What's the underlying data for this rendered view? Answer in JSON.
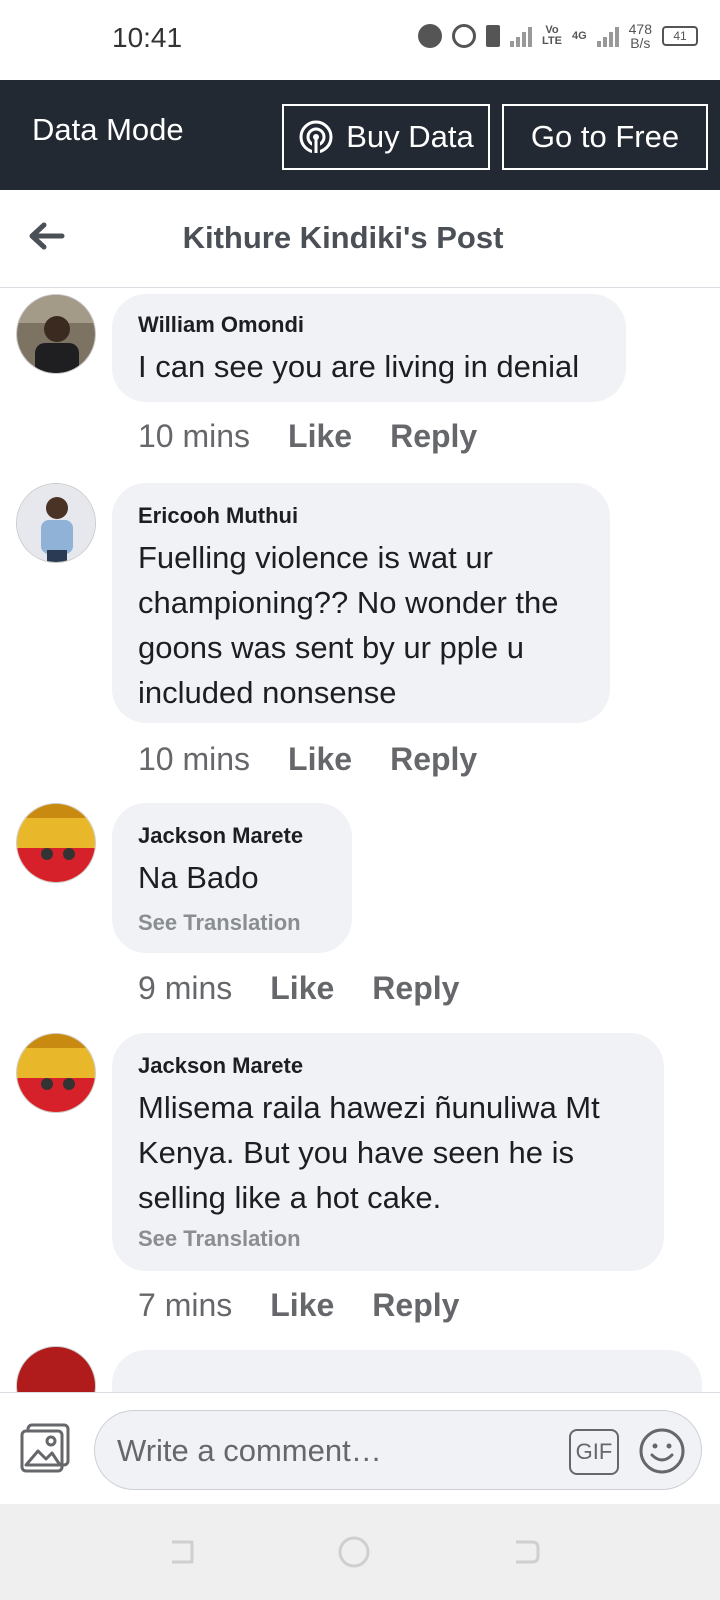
{
  "status": {
    "time": "10:41",
    "lte_top": "Vo",
    "lte_bottom": "LTE",
    "net": "4G",
    "speed_value": "478",
    "speed_unit": "B/s",
    "battery": "41"
  },
  "data_mode": {
    "title": "Data Mode",
    "buy_label": "Buy Data",
    "free_label": "Go to Free"
  },
  "header": {
    "title": "Kithure Kindiki's Post"
  },
  "comments": [
    {
      "author": "William Omondi",
      "text": "I can see you are living in denial",
      "time": "10 mins",
      "like": "Like",
      "reply": "Reply"
    },
    {
      "author": "Ericooh Muthui",
      "text": "Fuelling violence is wat ur championing?? No wonder the goons was sent by ur pple u included nonsense",
      "time": "10 mins",
      "like": "Like",
      "reply": "Reply"
    },
    {
      "author": "Jackson Marete",
      "text": "Na Bado",
      "see_translation": "See Translation",
      "time": "9 mins",
      "like": "Like",
      "reply": "Reply"
    },
    {
      "author": "Jackson Marete",
      "text": "Mlisema raila hawezi ñunuliwa Mt Kenya. But you have seen he is selling like a hot cake.",
      "see_translation": "See Translation",
      "time": "7 mins",
      "like": "Like",
      "reply": "Reply"
    }
  ],
  "composer": {
    "placeholder": "Write a comment…",
    "gif_label": "GIF"
  },
  "icons": {
    "back": "arrow-left-icon",
    "broadcast": "broadcast-icon",
    "photo": "photo-icon",
    "emoji": "emoji-icon",
    "gif": "gif-icon"
  },
  "colors": {
    "databar_bg": "#232933",
    "bubble_bg": "#f0f2f5",
    "meta_text": "#65676b"
  }
}
